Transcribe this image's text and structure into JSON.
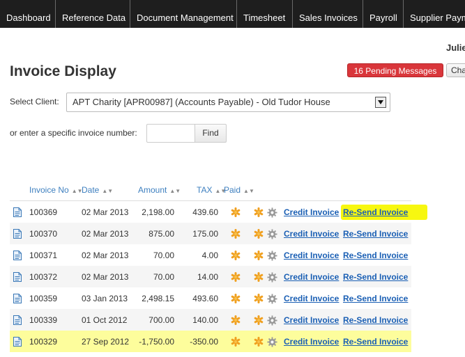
{
  "nav": [
    {
      "label": "Dashboard"
    },
    {
      "label": "Reference Data"
    },
    {
      "label": "Document Management"
    },
    {
      "label": "Timesheet"
    },
    {
      "label": "Sales Invoices"
    },
    {
      "label": "Payroll"
    },
    {
      "label": "Supplier Paym"
    }
  ],
  "user": {
    "name": "Julie"
  },
  "page": {
    "title": "Invoice Display"
  },
  "messages": {
    "pending_label": "16 Pending Messages",
    "cha_label": "Cha"
  },
  "client": {
    "label": "Select Client:",
    "selected": "APT Charity [APR00987] (Accounts Payable) - Old Tudor House"
  },
  "invoice_search": {
    "label": "or enter a specific invoice number:",
    "value": "",
    "find_label": "Find"
  },
  "table": {
    "columns": [
      "Invoice No",
      "Date",
      "Amount",
      "TAX",
      "Paid"
    ],
    "rows": [
      {
        "invoice_no": "100369",
        "date": "02 Mar 2013",
        "amount": "2,198.00",
        "tax": "439.60",
        "credit": "Credit Invoice",
        "resend": "Re-Send Invoice"
      },
      {
        "invoice_no": "100370",
        "date": "02 Mar 2013",
        "amount": "875.00",
        "tax": "175.00",
        "credit": "Credit Invoice",
        "resend": "Re-Send Invoice"
      },
      {
        "invoice_no": "100371",
        "date": "02 Mar 2013",
        "amount": "70.00",
        "tax": "4.00",
        "credit": "Credit Invoice",
        "resend": "Re-Send Invoice"
      },
      {
        "invoice_no": "100372",
        "date": "02 Mar 2013",
        "amount": "70.00",
        "tax": "14.00",
        "credit": "Credit Invoice",
        "resend": "Re-Send Invoice"
      },
      {
        "invoice_no": "100359",
        "date": "03 Jan 2013",
        "amount": "2,498.15",
        "tax": "493.60",
        "credit": "Credit Invoice",
        "resend": "Re-Send Invoice"
      },
      {
        "invoice_no": "100339",
        "date": "01 Oct 2012",
        "amount": "700.00",
        "tax": "140.00",
        "credit": "Credit Invoice",
        "resend": "Re-Send Invoice"
      },
      {
        "invoice_no": "100329",
        "date": "27 Sep 2012",
        "amount": "-1,750.00",
        "tax": "-350.00",
        "credit": "Credit Invoice",
        "resend": "Re-Send Invoice"
      }
    ]
  },
  "icons": {
    "row": "document-icon",
    "paid": "asterisk-icon",
    "actions": [
      "asterisk-icon",
      "gear-icon"
    ]
  },
  "colors": {
    "nav_bg": "#1e1e1e",
    "pending_bg": "#d9363b",
    "link": "#1a5fb4",
    "highlight_row": "#fdfd9c",
    "highlight_link": "#f7f710"
  }
}
